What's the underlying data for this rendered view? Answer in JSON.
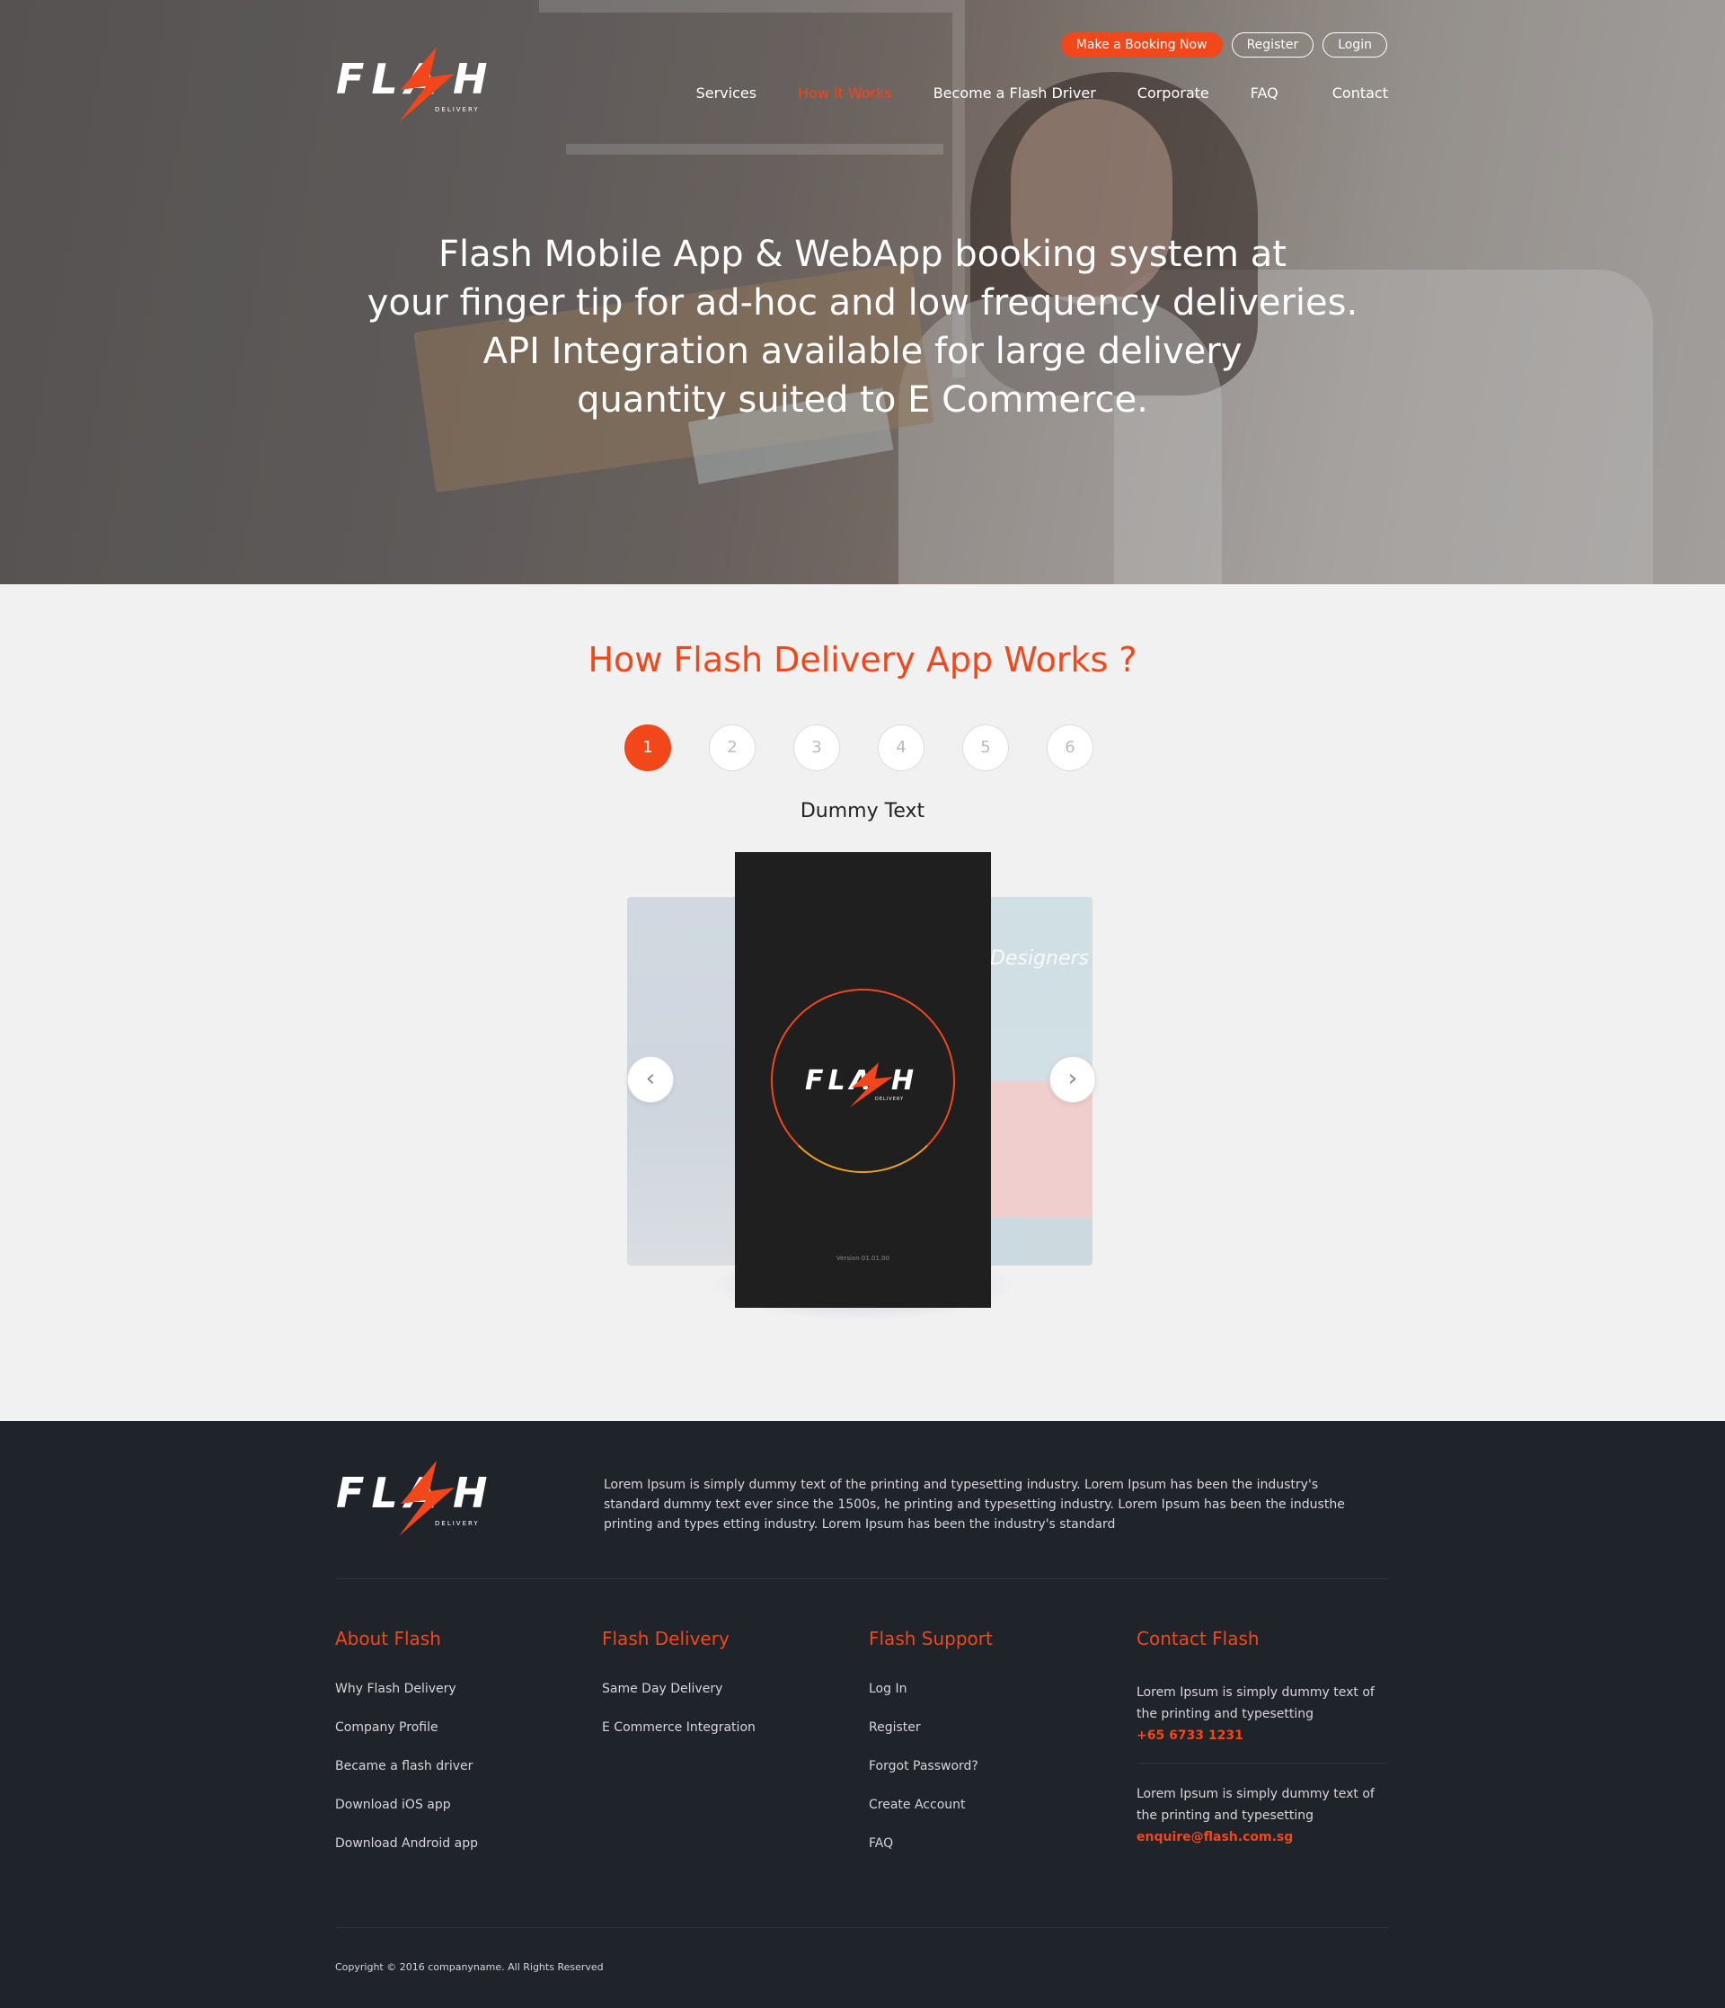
{
  "brand": {
    "logo_word": "FLA⚡H",
    "logo_sub": "DELIVERY",
    "accent": "#f2471a",
    "footer_bg": "#1f232a"
  },
  "header": {
    "buttons": {
      "booking": "Make a Booking Now",
      "register": "Register",
      "login": "Login"
    },
    "nav": [
      {
        "label": "Services"
      },
      {
        "label": "How it Works"
      },
      {
        "label": "Become a Flash Driver"
      },
      {
        "label": "Corporate"
      },
      {
        "label": "FAQ"
      },
      {
        "label": "Contact"
      }
    ]
  },
  "hero": {
    "line1": "Flash Mobile App & WebApp booking system at",
    "line2": "your finger tip for ad-hoc and low frequency deliveries.",
    "line3": "API Integration available for large delivery",
    "line4": "quantity suited to E Commerce."
  },
  "how": {
    "title": "How Flash Delivery App Works ?",
    "steps": [
      "1",
      "2",
      "3",
      "4",
      "5",
      "6"
    ],
    "active_step": "1",
    "caption": "Dummy Text",
    "phone_version": "Version 01.01.00",
    "right_preview_text": "Designers",
    "prev_icon": "chevron-left-icon",
    "next_icon": "chevron-right-icon"
  },
  "footer": {
    "description": "Lorem Ipsum is simply dummy text of the printing and typesetting industry. Lorem Ipsum has been the industry's standard dummy text ever since the 1500s, he printing and typesetting industry. Lorem Ipsum has been the industhe printing and types etting industry. Lorem Ipsum has been the industry's standard",
    "about": {
      "title": "About Flash",
      "links": [
        "Why Flash Delivery",
        "Company Profile",
        "Became a flash driver",
        "Download iOS app",
        "Download Android app"
      ]
    },
    "delivery": {
      "title": "Flash Delivery",
      "links": [
        "Same Day Delivery",
        "E Commerce Integration"
      ]
    },
    "support": {
      "title": "Flash Support",
      "links": [
        "Log In",
        "Register",
        "Forgot Password?",
        "Create Account",
        "FAQ"
      ]
    },
    "contact": {
      "title": "Contact Flash",
      "phone_text": "Lorem Ipsum is simply dummy text of the printing and typesetting",
      "phone": "+65 6733 1231",
      "email_text": "Lorem Ipsum is simply dummy text of the printing and typesetting",
      "email": "enquire@flash.com.sg"
    },
    "copyright": "Copyright © 2016 companyname. All Rights Reserved"
  }
}
